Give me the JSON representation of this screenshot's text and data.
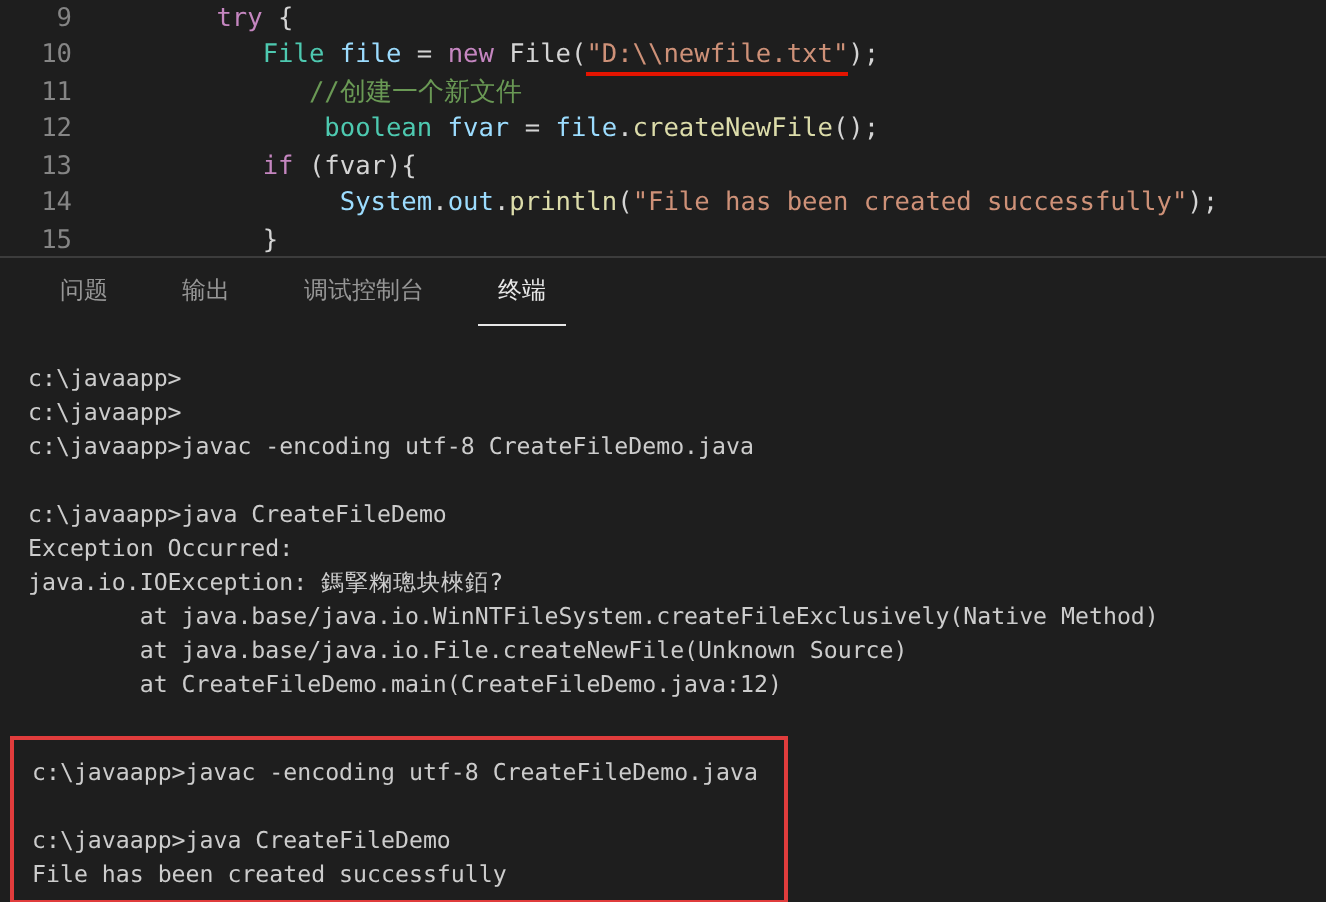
{
  "editor": {
    "lines": [
      {
        "number": "9",
        "tokens": [
          {
            "kind": "keyword",
            "text": "      try"
          },
          {
            "kind": "plain",
            "text": " {"
          }
        ]
      },
      {
        "number": "10",
        "tokens": [
          {
            "kind": "type",
            "text": "         File"
          },
          {
            "kind": "variable",
            "text": " file"
          },
          {
            "kind": "plain",
            "text": " = "
          },
          {
            "kind": "keyword",
            "text": "new"
          },
          {
            "kind": "plain",
            "text": " File("
          },
          {
            "kind": "string",
            "text": "\"D:\\\\newfile.txt\"",
            "underlined": true
          },
          {
            "kind": "plain",
            "text": ");"
          }
        ]
      },
      {
        "number": "11",
        "tokens": [
          {
            "kind": "comment",
            "text": "            //创建一个新文件"
          }
        ]
      },
      {
        "number": "12",
        "tokens": [
          {
            "kind": "type",
            "text": "             boolean"
          },
          {
            "kind": "variable",
            "text": " fvar"
          },
          {
            "kind": "plain",
            "text": " = "
          },
          {
            "kind": "variable",
            "text": "file"
          },
          {
            "kind": "plain",
            "text": "."
          },
          {
            "kind": "function",
            "text": "createNewFile"
          },
          {
            "kind": "plain",
            "text": "();"
          }
        ]
      },
      {
        "number": "13",
        "tokens": [
          {
            "kind": "keyword",
            "text": "         if"
          },
          {
            "kind": "plain",
            "text": " (fvar){"
          }
        ]
      },
      {
        "number": "14",
        "tokens": [
          {
            "kind": "variable",
            "text": "              System"
          },
          {
            "kind": "plain",
            "text": "."
          },
          {
            "kind": "variable",
            "text": "out"
          },
          {
            "kind": "plain",
            "text": "."
          },
          {
            "kind": "function",
            "text": "println"
          },
          {
            "kind": "plain",
            "text": "("
          },
          {
            "kind": "string",
            "text": "\"File has been created successfully\"",
            "underlined": false
          },
          {
            "kind": "plain",
            "text": ");"
          }
        ]
      },
      {
        "number": "15",
        "tokens": [
          {
            "kind": "plain",
            "text": "         }"
          }
        ]
      }
    ]
  },
  "panel_tabs": [
    {
      "label": "问题",
      "selected": false
    },
    {
      "label": "输出",
      "selected": false
    },
    {
      "label": "调试控制台",
      "selected": false
    },
    {
      "label": "终端",
      "selected": true
    }
  ],
  "terminal": {
    "output": [
      [
        "c:\\javaapp>",
        "c:\\javaapp>",
        "c:\\javaapp>javac -encoding utf-8 CreateFileDemo.java"
      ],
      [
        "c:\\javaapp>java CreateFileDemo",
        "Exception Occurred:",
        "java.io.IOException: 鎷掔粷璁块棶銆?",
        "        at java.base/java.io.WinNTFileSystem.createFileExclusively(Native Method)",
        "        at java.base/java.io.File.createNewFile(Unknown Source)",
        "        at CreateFileDemo.main(CreateFileDemo.java:12)"
      ]
    ],
    "highlighted_output": [
      [
        "c:\\javaapp>javac -encoding utf-8 CreateFileDemo.java"
      ],
      [
        "c:\\javaapp>java CreateFileDemo",
        "File has been created successfully"
      ]
    ]
  }
}
